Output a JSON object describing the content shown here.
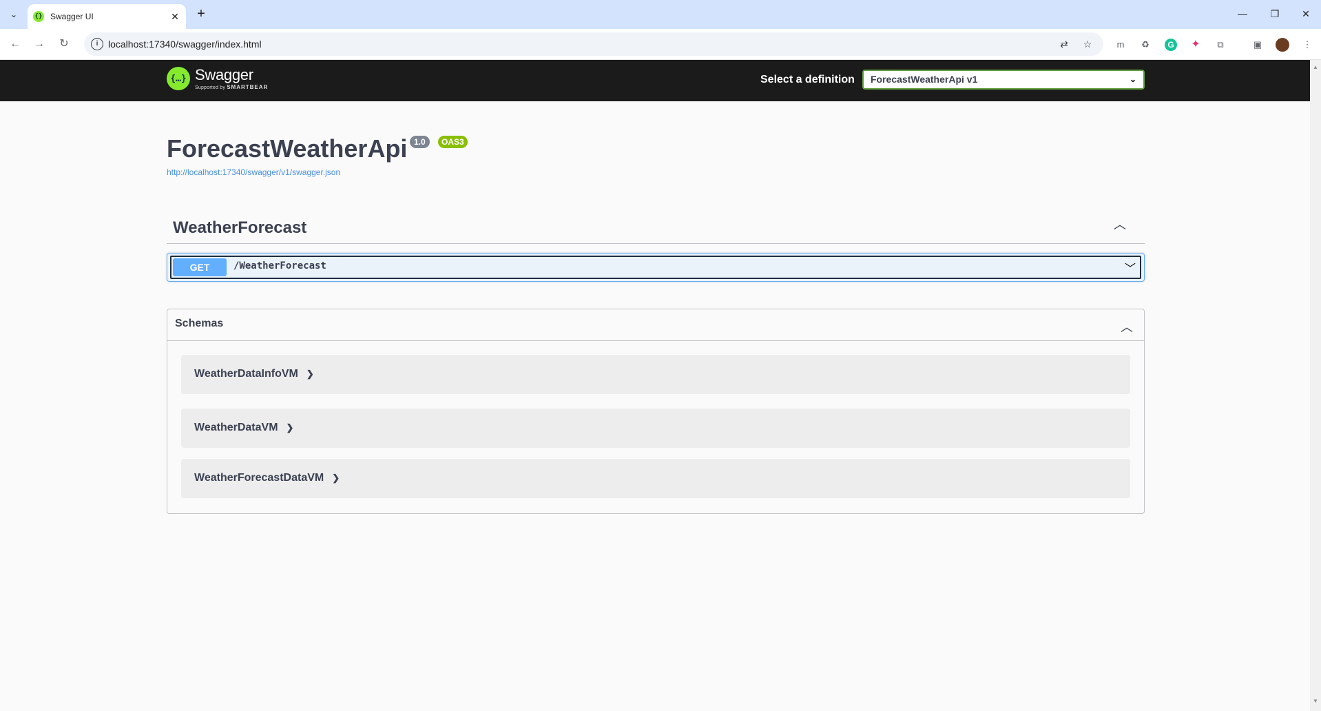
{
  "browser": {
    "tab_title": "Swagger UI",
    "tab_close": "✕",
    "new_tab": "+",
    "url": "localhost:17340/swagger/index.html"
  },
  "swagger": {
    "brand_name": "Swagger",
    "brand_sub_prefix": "Supported by",
    "brand_sub_name": "SMARTBEAR",
    "select_label": "Select a definition",
    "selected_definition": "ForecastWeatherApi v1",
    "api_title": "ForecastWeatherApi",
    "version_badge": "1.0",
    "oas_badge": "OAS3",
    "spec_url": "http://localhost:17340/swagger/v1/swagger.json",
    "tag": "WeatherForecast",
    "operation": {
      "method": "GET",
      "path": "/WeatherForecast"
    },
    "schemas_title": "Schemas",
    "models": [
      "WeatherDataInfoVM",
      "WeatherDataVM",
      "WeatherForecastDataVM"
    ]
  },
  "colors": {
    "topbar": "#1b1b1b",
    "swagger_green": "#85ea2d",
    "get_blue": "#61affe",
    "select_border": "#62a03f",
    "oas_badge": "#89bf04",
    "version_badge": "#7d8492",
    "link": "#4990e2"
  },
  "icons": {
    "tab_list": "chevron-down-icon",
    "back": "arrow-left-icon",
    "forward": "arrow-right-icon",
    "reload": "reload-icon",
    "translate": "translate-icon",
    "bookmark": "star-icon",
    "extensions": "puzzle-icon"
  }
}
